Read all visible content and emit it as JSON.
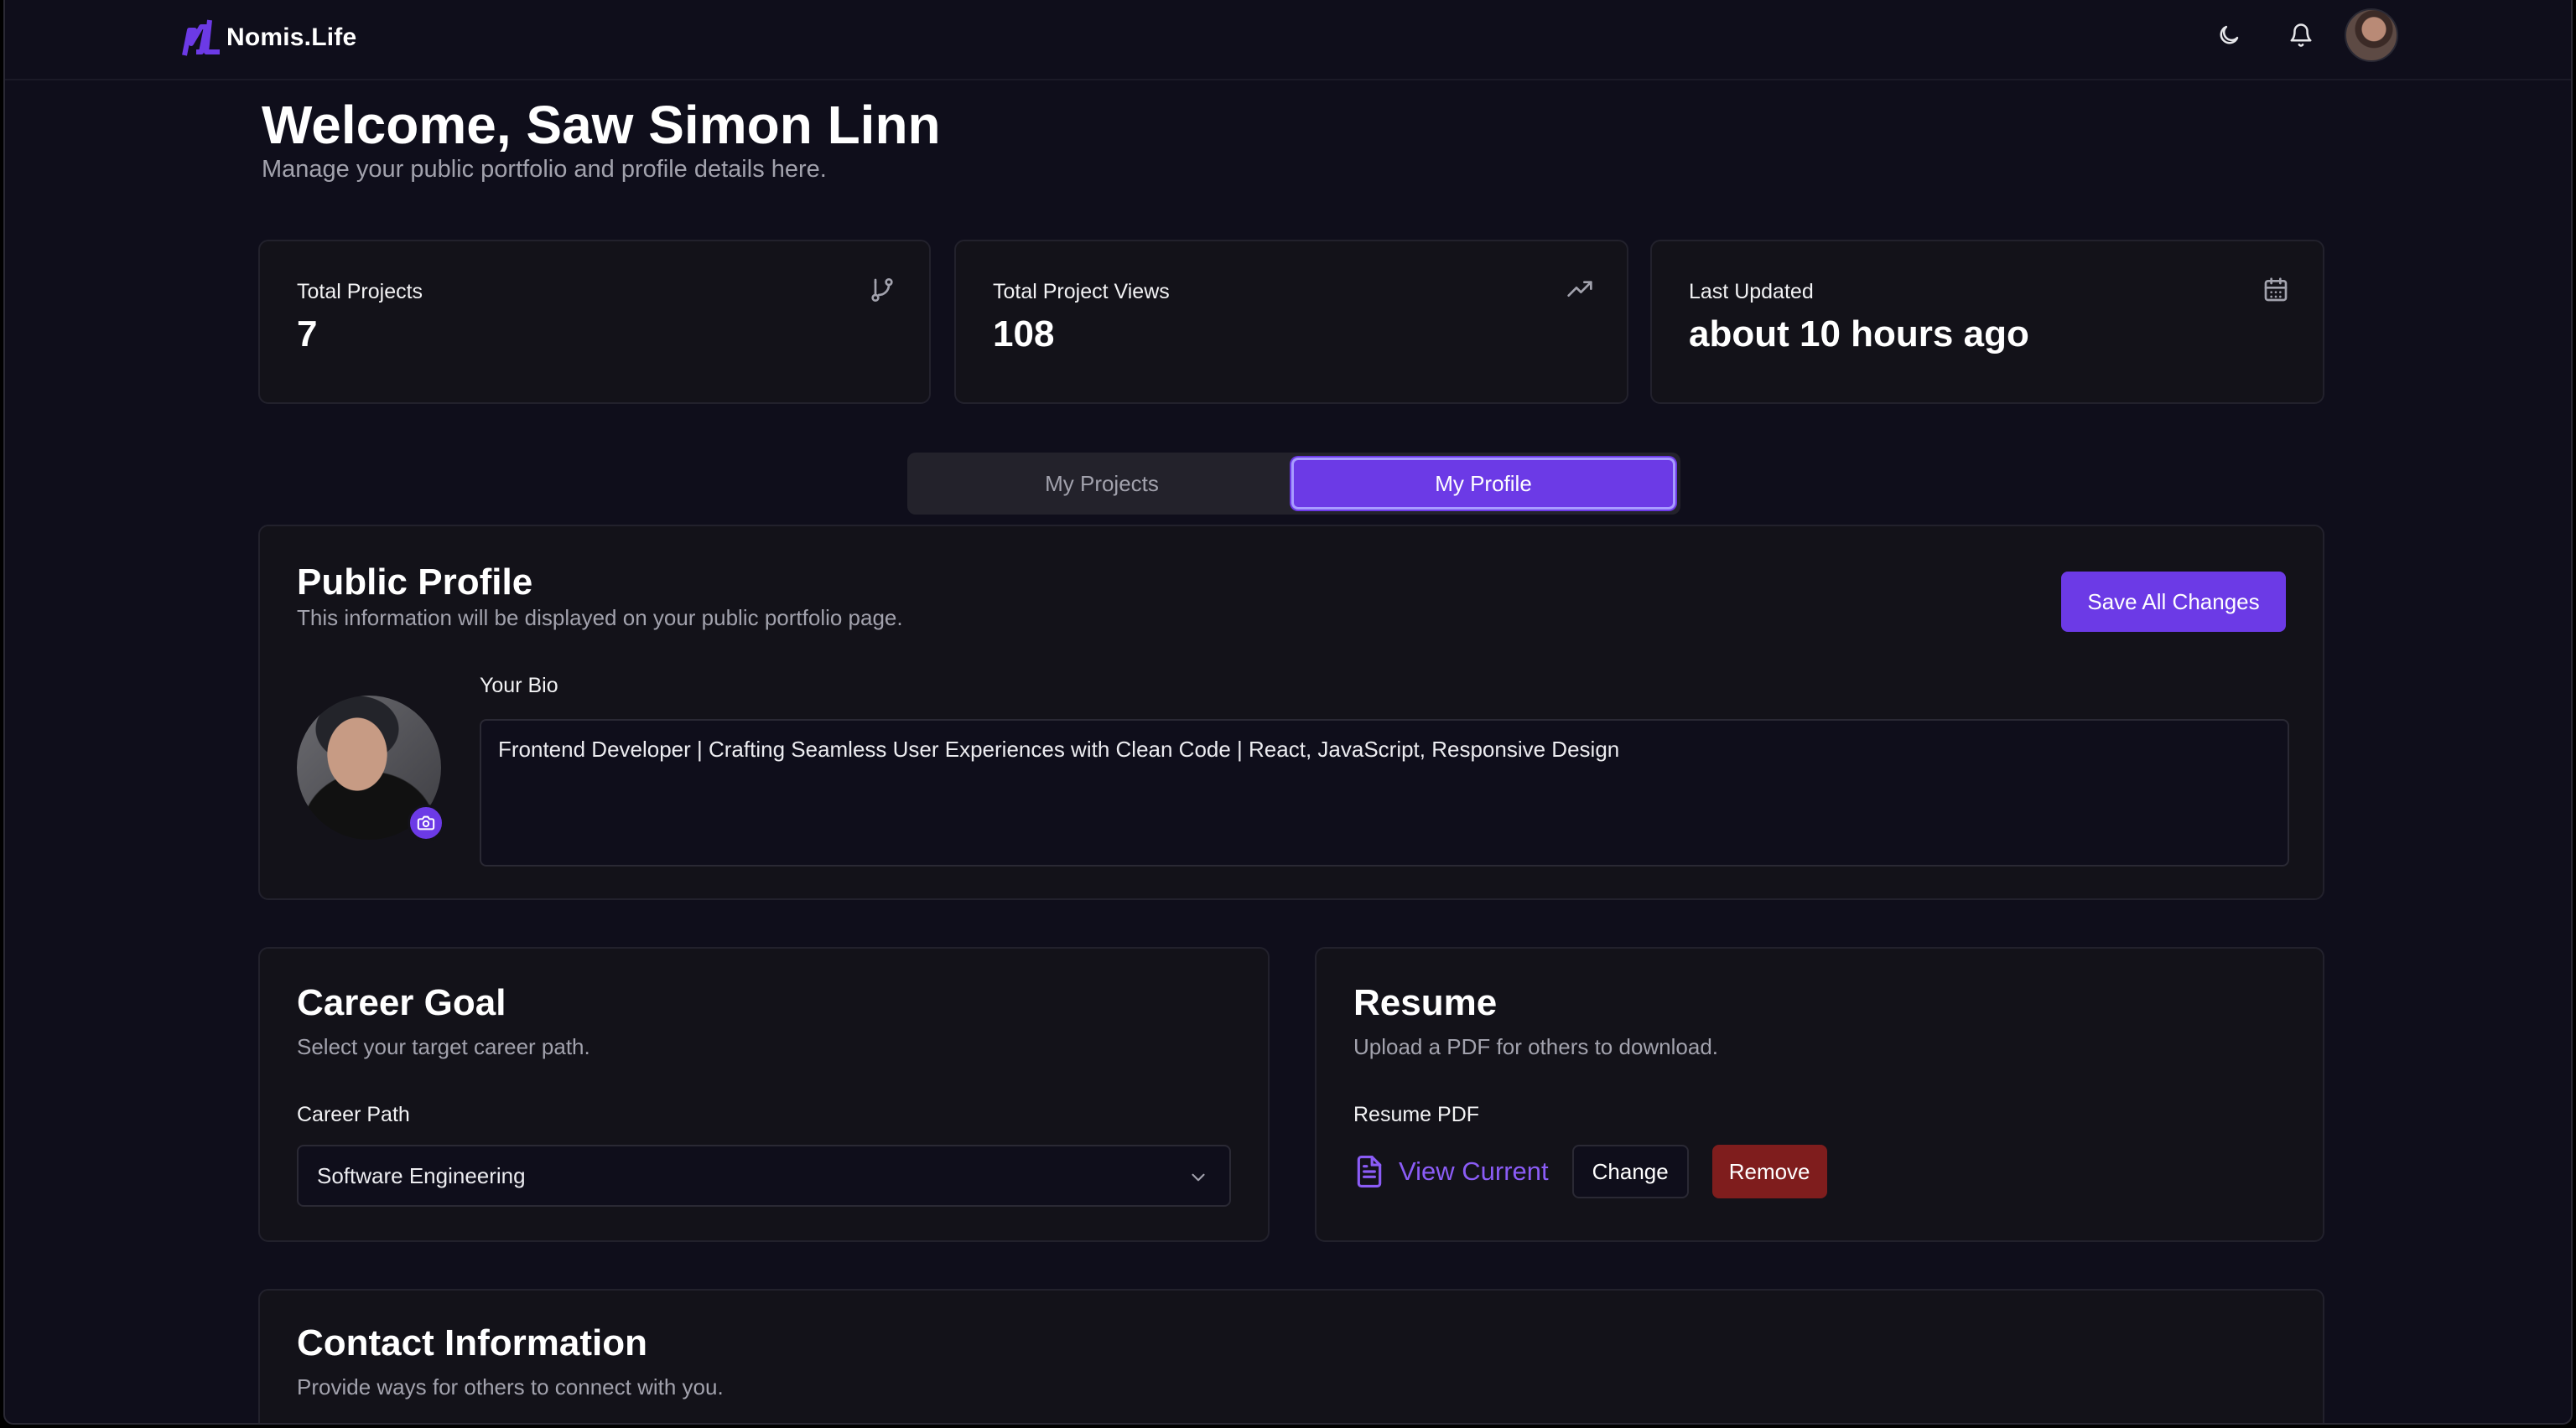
{
  "brand": {
    "name": "Nomis.Life",
    "accent": "#6c3ae6"
  },
  "header": {
    "icons": [
      "moon-icon",
      "bell-icon",
      "avatar"
    ]
  },
  "welcome": {
    "title": "Welcome, Saw Simon Linn",
    "subtitle": "Manage your public portfolio and profile details here."
  },
  "stats": [
    {
      "label": "Total Projects",
      "value": "7",
      "icon": "git-branch-icon"
    },
    {
      "label": "Total Project Views",
      "value": "108",
      "icon": "trending-up-icon"
    },
    {
      "label": "Last Updated",
      "value": "about 10 hours ago",
      "icon": "calendar-icon"
    }
  ],
  "tabs": [
    {
      "label": "My Projects",
      "active": false
    },
    {
      "label": "My Profile",
      "active": true
    }
  ],
  "public_profile": {
    "title": "Public Profile",
    "subtitle": "This information will be displayed on your public portfolio page.",
    "save_label": "Save All Changes",
    "bio_label": "Your Bio",
    "bio_value": "Frontend Developer | Crafting Seamless User Experiences with Clean Code | React, JavaScript, Responsive Design"
  },
  "career": {
    "title": "Career Goal",
    "subtitle": "Select your target career path.",
    "field_label": "Career Path",
    "selected": "Software Engineering"
  },
  "resume": {
    "title": "Resume",
    "subtitle": "Upload a PDF for others to download.",
    "field_label": "Resume PDF",
    "view_label": "View Current",
    "change_label": "Change",
    "remove_label": "Remove",
    "danger_color": "#7f1d1d"
  },
  "contact": {
    "title": "Contact Information",
    "subtitle": "Provide ways for others to connect with you."
  }
}
